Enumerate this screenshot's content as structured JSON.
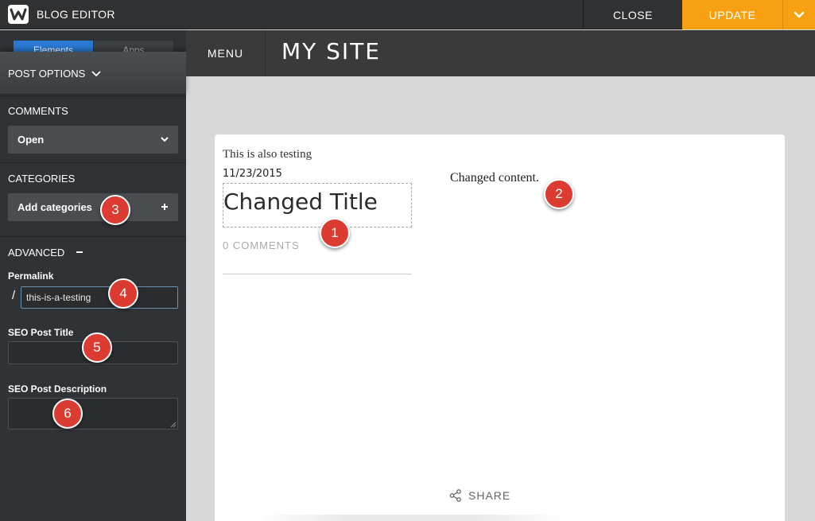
{
  "topbar": {
    "app_title": "BLOG EDITOR",
    "close_label": "CLOSE",
    "update_label": "UPDATE"
  },
  "sidebar": {
    "tabs": [
      {
        "label": "Elements",
        "active": true
      },
      {
        "label": "Apps",
        "active": false
      }
    ],
    "post_options_label": "POST OPTIONS",
    "comments": {
      "label": "COMMENTS",
      "value": "Open"
    },
    "categories": {
      "label": "CATEGORIES",
      "add_label": "Add categories"
    },
    "advanced": {
      "label": "ADVANCED",
      "permalink_label": "Permalink",
      "permalink_prefix": "/",
      "permalink_value": "this-is-a-testing",
      "seo_title_label": "SEO Post Title",
      "seo_title_value": "",
      "seo_description_label": "SEO Post Description",
      "seo_description_value": ""
    }
  },
  "site": {
    "menu_label": "MENU",
    "title": "MY SITE"
  },
  "post": {
    "category_line": "This is also testing",
    "date": "11/23/2015",
    "title": "Changed Title",
    "comments_count": "0 COMMENTS",
    "body": "Changed content.",
    "share_label": "SHARE"
  },
  "markers": [
    "1",
    "2",
    "3",
    "4",
    "5",
    "6"
  ],
  "colors": {
    "accent": "#f7a011",
    "marker": "#dc3b31",
    "tab_active": "#2a7ad5"
  }
}
